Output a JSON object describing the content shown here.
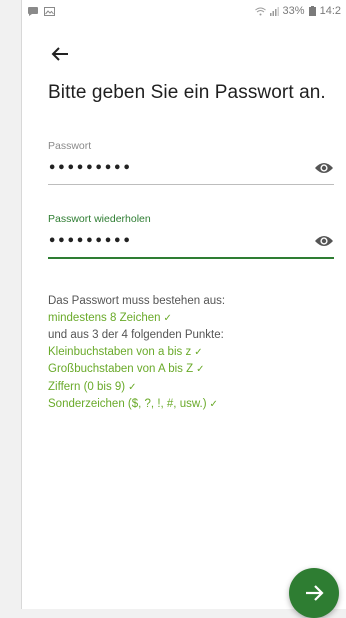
{
  "status_bar": {
    "signal_text": "33%",
    "time": "14:2"
  },
  "page": {
    "title": "Bitte geben Sie ein Passwort an."
  },
  "fields": [
    {
      "label": "Passwort",
      "value": "•••••••••",
      "active": false
    },
    {
      "label": "Passwort wiederholen",
      "value": "•••••••••",
      "active": true
    }
  ],
  "rules": {
    "intro": "Das Passwort muss bestehen aus:",
    "min_length": "mindestens 8 Zeichen",
    "subtitle": "und aus 3 der 4 folgenden Punkte:",
    "items": [
      "Kleinbuchstaben von a bis z",
      "Großbuchstaben von A bis Z",
      "Ziffern (0 bis 9)",
      "Sonderzeichen ($, ?, !, #, usw.)"
    ],
    "check_mark": "✓"
  },
  "colors": {
    "accent": "#2e7d32",
    "ok": "#6aaa2a"
  },
  "icons": {
    "back": "arrow-left-icon",
    "eye": "eye-icon",
    "next": "arrow-right-icon"
  }
}
